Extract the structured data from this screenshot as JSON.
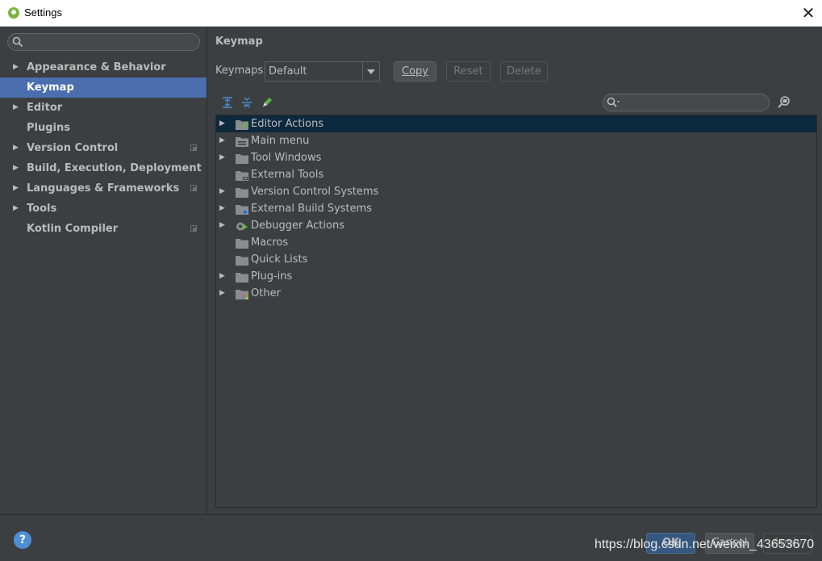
{
  "window": {
    "title": "Settings"
  },
  "colors": {
    "selection": "#4b6eaf",
    "tree_selection": "#0d293e",
    "background": "#3c3f41",
    "ok_button": "#365880",
    "help": "#4d8fd6"
  },
  "sidebar": {
    "search_icon": "search-icon",
    "items": [
      {
        "label": "Appearance & Behavior",
        "expandable": true,
        "selected": false
      },
      {
        "label": "Keymap",
        "expandable": false,
        "selected": true
      },
      {
        "label": "Editor",
        "expandable": true,
        "selected": false
      },
      {
        "label": "Plugins",
        "expandable": false,
        "selected": false
      },
      {
        "label": "Version Control",
        "expandable": true,
        "selected": false,
        "project": true
      },
      {
        "label": "Build, Execution, Deployment",
        "expandable": true,
        "selected": false
      },
      {
        "label": "Languages & Frameworks",
        "expandable": true,
        "selected": false,
        "project": true
      },
      {
        "label": "Tools",
        "expandable": true,
        "selected": false
      },
      {
        "label": "Kotlin Compiler",
        "expandable": false,
        "selected": false,
        "project": true
      }
    ]
  },
  "main": {
    "title": "Keymap",
    "keymaps_label": "Keymaps:",
    "keymap_selected": "Default",
    "buttons": {
      "copy": "Copy",
      "reset": "Reset",
      "delete": "Delete"
    },
    "toolbar_icons": [
      "expand-all-icon",
      "collapse-all-icon",
      "edit-shortcuts-icon"
    ],
    "tree": [
      {
        "label": "Editor Actions",
        "expandable": true,
        "selected": true,
        "icon": "editor-actions-icon"
      },
      {
        "label": "Main menu",
        "expandable": true,
        "selected": false,
        "icon": "main-menu-icon"
      },
      {
        "label": "Tool Windows",
        "expandable": true,
        "selected": false,
        "icon": "folder-icon"
      },
      {
        "label": "External Tools",
        "expandable": false,
        "selected": false,
        "icon": "external-tools-icon"
      },
      {
        "label": "Version Control Systems",
        "expandable": true,
        "selected": false,
        "icon": "folder-icon"
      },
      {
        "label": "External Build Systems",
        "expandable": true,
        "selected": false,
        "icon": "external-build-icon"
      },
      {
        "label": "Debugger Actions",
        "expandable": true,
        "selected": false,
        "icon": "debugger-icon"
      },
      {
        "label": "Macros",
        "expandable": false,
        "selected": false,
        "icon": "folder-icon"
      },
      {
        "label": "Quick Lists",
        "expandable": false,
        "selected": false,
        "icon": "folder-icon"
      },
      {
        "label": "Plug-ins",
        "expandable": true,
        "selected": false,
        "icon": "folder-icon"
      },
      {
        "label": "Other",
        "expandable": true,
        "selected": false,
        "icon": "other-icon"
      }
    ]
  },
  "footer": {
    "help": "?",
    "ok": "OK",
    "cancel": "Cancel",
    "apply": "Apply",
    "watermark": "https://blog.csdn.net/weixin_43653670"
  }
}
